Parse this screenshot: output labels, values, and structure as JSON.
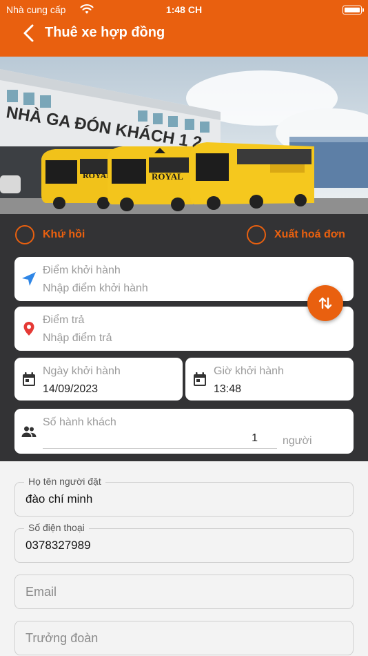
{
  "status_bar": {
    "carrier": "Nhà cung cấp",
    "time": "1:48 CH"
  },
  "header": {
    "title": "Thuê xe hợp đồng"
  },
  "banner": {
    "sign_text": "NHÀ GA ĐÓN KHÁCH 1 2",
    "bus_brand": "ROYAL"
  },
  "options": {
    "round_trip_label": "Khứ hồi",
    "invoice_label": "Xuất hoá đơn"
  },
  "route": {
    "departure": {
      "label": "Điểm khởi hành",
      "placeholder": "Nhập điểm khởi hành"
    },
    "destination": {
      "label": "Điểm trả",
      "placeholder": "Nhập điểm trả"
    }
  },
  "schedule": {
    "date": {
      "label": "Ngày khởi hành",
      "value": "14/09/2023"
    },
    "time": {
      "label": "Giờ khởi hành",
      "value": "13:48"
    }
  },
  "passengers": {
    "label": "Số hành khách",
    "value": "1",
    "unit": "người"
  },
  "contact": {
    "name": {
      "label": "Họ tên người đặt",
      "value": "đào chí minh"
    },
    "phone": {
      "label": "Số điện thoại",
      "value": "0378327989"
    },
    "email": {
      "placeholder": "Email"
    },
    "leader": {
      "placeholder": "Trưởng đoàn"
    }
  },
  "colors": {
    "accent": "#e9600f",
    "dark_panel": "#333335",
    "location_blue": "#2f86e6",
    "location_red": "#e53935"
  }
}
